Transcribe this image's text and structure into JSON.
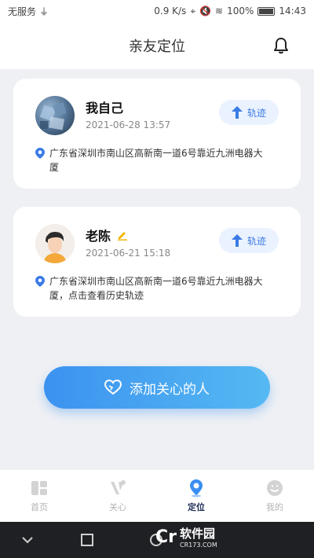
{
  "status_bar": {
    "carrier": "无服务",
    "speed": "0.9 K/s",
    "battery": "100%",
    "time": "14:43"
  },
  "header": {
    "title": "亲友定位"
  },
  "contacts": [
    {
      "name": "我自己",
      "time": "2021-06-28 13:57",
      "track_label": "轨迹",
      "address": "广东省深圳市南山区高新南一道6号靠近九洲电器大厦"
    },
    {
      "name": "老陈",
      "time": "2021-06-21 15:18",
      "track_label": "轨迹",
      "address": "广东省深圳市南山区高新南一道6号靠近九洲电器大厦，点击查看历史轨迹"
    }
  ],
  "add_button": {
    "label": "添加关心的人"
  },
  "tabs": [
    {
      "label": "首页",
      "icon": "home-icon",
      "active": false
    },
    {
      "label": "关心",
      "icon": "care-icon",
      "active": false
    },
    {
      "label": "定位",
      "icon": "location-icon",
      "active": true
    },
    {
      "label": "我的",
      "icon": "profile-icon",
      "active": false
    }
  ],
  "watermark": {
    "brand": "软件园",
    "site": "CR173.COM"
  },
  "colors": {
    "accent": "#3a7be6",
    "button_gradient_start": "#3c92f0",
    "button_gradient_end": "#55b9f2",
    "tab_active": "#1e2f57",
    "tab_inactive": "#b3b3b3",
    "edit_icon": "#f4b400"
  }
}
